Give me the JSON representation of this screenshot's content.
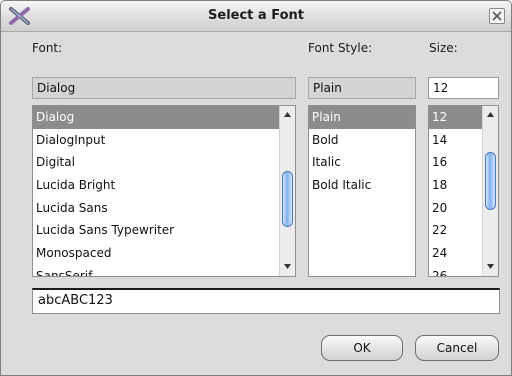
{
  "dialog": {
    "title": "Select a Font",
    "icons": {
      "app": "crossed-tools-icon",
      "close": "close-icon"
    }
  },
  "font": {
    "label": "Font:",
    "value": "Dialog",
    "items": [
      "Dialog",
      "DialogInput",
      "Digital",
      "Lucida Bright",
      "Lucida Sans",
      "Lucida Sans Typewriter",
      "Monospaced",
      "SansSerif"
    ],
    "selected": "Dialog"
  },
  "style": {
    "label": "Font Style:",
    "value": "Plain",
    "items": [
      "Plain",
      "Bold",
      "Italic",
      "Bold Italic"
    ],
    "selected": "Plain"
  },
  "size": {
    "label": "Size:",
    "value": "12",
    "items": [
      "12",
      "14",
      "16",
      "18",
      "20",
      "22",
      "24",
      "26"
    ],
    "selected": "12"
  },
  "preview": {
    "text": "abcABC123"
  },
  "buttons": {
    "ok": "OK",
    "cancel": "Cancel"
  },
  "colors": {
    "selection": "#8c8c8c",
    "scroll_thumb": "#7fb0ee",
    "dialog_bg": "#dcdcdc"
  }
}
